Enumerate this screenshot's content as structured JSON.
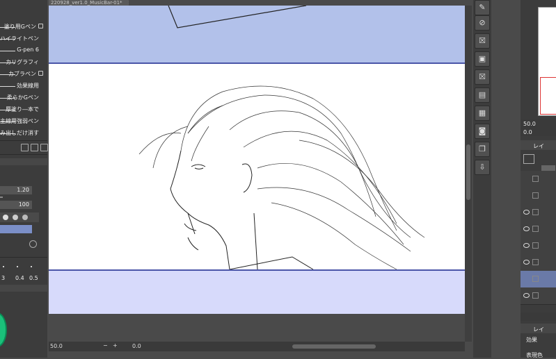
{
  "document_tab": {
    "title": "220928_ver1.0_MusicBar-01*"
  },
  "brush_list": [
    {
      "label": "塗り用Gペン",
      "locked": true
    },
    {
      "label": "ハイライトペン",
      "locked": false
    },
    {
      "label": "G-pen 6",
      "locked": false
    },
    {
      "label": "カリグラフィ",
      "locked": false
    },
    {
      "label": "カブラペン",
      "locked": true
    },
    {
      "label": "効果線用",
      "locked": false
    },
    {
      "label": "柔らかGペン",
      "locked": false
    },
    {
      "label": "厚塗り―本で",
      "locked": false
    },
    {
      "label": "主線用強弱ペン",
      "locked": false
    },
    {
      "label": "はみ出しだけ消す",
      "locked": false
    }
  ],
  "brush_size": {
    "value": "1.20"
  },
  "opacity": {
    "value": "100"
  },
  "size_presets": [
    "3",
    "0.4",
    "0.5"
  ],
  "status_bar": {
    "zoom": "50.0",
    "angle": "0.0"
  },
  "navigator": {
    "zoom": "50.0",
    "angle": "0.0"
  },
  "layer_panel": {
    "tab_label": "レイ",
    "bottom_tab_label": "レイ",
    "effect_label": "効果",
    "color_label": "表現色"
  },
  "colors": {
    "top_band": "#b2c1ea",
    "bottom_band": "#d7dafb",
    "frame_border": "#4a55a8",
    "accent_green": "#1ac07a",
    "ui_dark": "#3c3c3c"
  },
  "icons": [
    "close-icon",
    "lock-icon",
    "eye-icon",
    "folder-icon",
    "trash-icon",
    "copy-icon",
    "new-layer-icon",
    "export-icon"
  ]
}
